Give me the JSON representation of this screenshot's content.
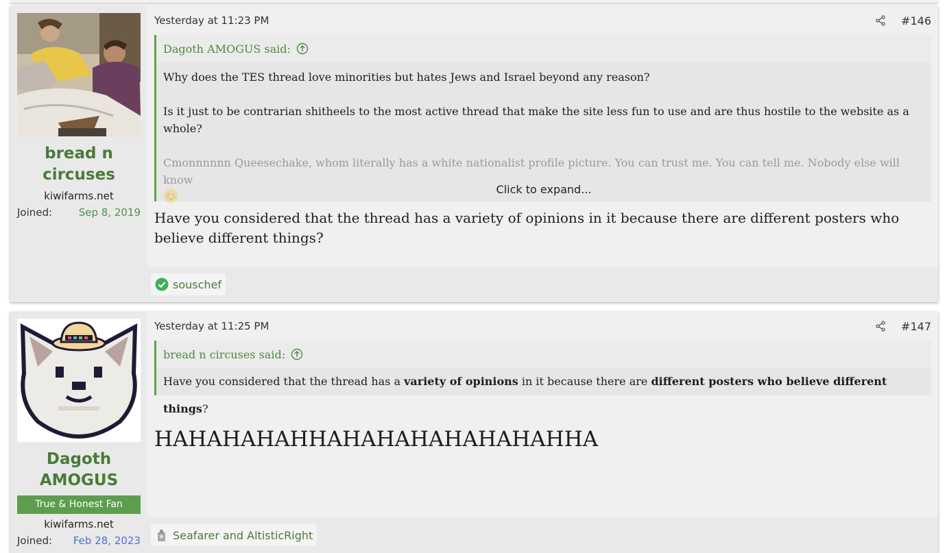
{
  "posts": [
    {
      "user": {
        "name": "bread n circuses",
        "site": "kiwifarms.net",
        "joined_label": "Joined:",
        "joined_date": "Sep 8, 2019"
      },
      "timestamp": "Yesterday at 11:23 PM",
      "number": "#146",
      "quote": {
        "author_line": "Dagoth AMOGUS said:",
        "paragraphs": [
          "Why does the TES thread love minorities but hates Jews and Israel beyond any reason?",
          "Is it just to be contrarian shitheels to the most active thread that make the site less fun to use and are thus hostile to the website as a whole?",
          "Cmonnnnnn Queesechake, whom literally has a white nationalist profile picture. You can trust me. You can tell me. Nobody else will know"
        ],
        "expand_label": "Click to expand..."
      },
      "message": "Have you considered that the thread has a variety of opinions in it because there are different posters who believe different things?",
      "reactions": "souschef"
    },
    {
      "user": {
        "name": "Dagoth AMOGUS",
        "title": "True & Honest Fan",
        "site": "kiwifarms.net",
        "joined_label": "Joined:",
        "joined_date": "Feb 28, 2023"
      },
      "timestamp": "Yesterday at 11:25 PM",
      "number": "#147",
      "quote": {
        "author_line": "bread n circuses said:",
        "text_a": "Have you considered that the thread has a ",
        "bold_a": "variety of opinions",
        "text_b": " in it because there are ",
        "bold_b": "different posters who believe different things",
        "text_c": "?"
      },
      "message": "HAHAHAHAHHAHAHAHAHAHAHAHHA",
      "reactions": "Seafarer and AltisticRight"
    }
  ],
  "colors": {
    "username": "#4a7a38",
    "quote_border": "#5da24d",
    "user_title_bg": "#5d9e4e",
    "joined_green": "#4e9446",
    "joined_blue": "#4a6fd0"
  },
  "icons": [
    "share-icon",
    "arrow-up-circle-icon",
    "check-reaction-icon",
    "bottle-reaction-icon",
    "blush-emoji-icon"
  ]
}
